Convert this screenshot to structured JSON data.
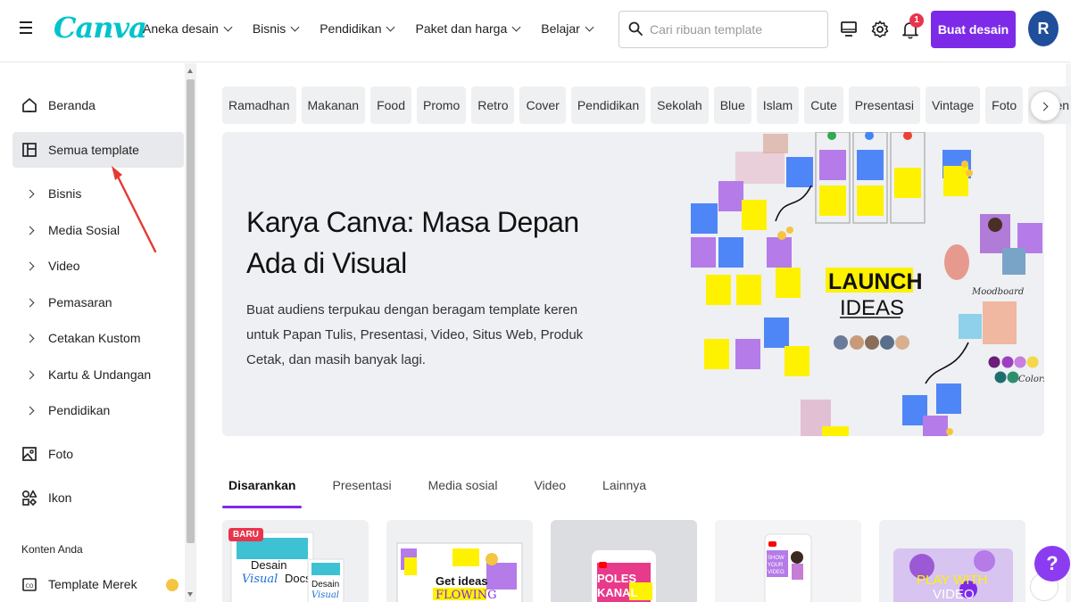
{
  "header": {
    "logo": "Canva",
    "nav": [
      "Aneka desain",
      "Bisnis",
      "Pendidikan",
      "Paket dan harga",
      "Belajar"
    ],
    "search_placeholder": "Cari ribuan template",
    "notification_count": "1",
    "create_label": "Buat desain",
    "avatar_initial": "R"
  },
  "sidebar": {
    "items": [
      {
        "label": "Beranda",
        "icon": "home-icon"
      },
      {
        "label": "Semua template",
        "icon": "template-icon"
      },
      {
        "label": "Bisnis",
        "icon": "chevron-right-icon"
      },
      {
        "label": "Media Sosial",
        "icon": "chevron-right-icon"
      },
      {
        "label": "Video",
        "icon": "chevron-right-icon"
      },
      {
        "label": "Pemasaran",
        "icon": "chevron-right-icon"
      },
      {
        "label": "Cetakan Kustom",
        "icon": "chevron-right-icon"
      },
      {
        "label": "Kartu & Undangan",
        "icon": "chevron-right-icon"
      },
      {
        "label": "Pendidikan",
        "icon": "chevron-right-icon"
      },
      {
        "label": "Foto",
        "icon": "photo-icon"
      },
      {
        "label": "Ikon",
        "icon": "shapes-icon"
      }
    ],
    "section_title": "Konten Anda",
    "brand_item": "Template Merek"
  },
  "chips": [
    "Ramadhan",
    "Makanan",
    "Food",
    "Promo",
    "Retro",
    "Cover",
    "Pendidikan",
    "Sekolah",
    "Blue",
    "Islam",
    "Cute",
    "Presentasi",
    "Vintage",
    "Foto",
    "Green"
  ],
  "hero": {
    "title_line1": "Karya Canva: Masa Depan",
    "title_line2": "Ada di Visual",
    "description": "Buat audiens terpukau dengan beragam template keren untuk Papan Tulis, Presentasi, Video, Situs Web, Produk Cetak, dan masih banyak lagi.",
    "art_launch_line1": "LAUNCH",
    "art_launch_line2": "IDEAS",
    "art_moodboard": "Moodboard",
    "art_colors": "Colors"
  },
  "tabs": [
    "Disarankan",
    "Presentasi",
    "Media sosial",
    "Video",
    "Lainnya"
  ],
  "cards": {
    "new_badge": "BARU",
    "card1_line1": "Desain",
    "card1_line2": "Visual",
    "card1_line3": "Docs",
    "card2_line1": "Get ideas",
    "card2_line2": "FLOWING",
    "card3_line1": "POLES",
    "card3_line2": "KANAL",
    "card4_line1": "SHOW",
    "card4_line2": "YOUR",
    "card4_line3": "VIDEO",
    "card5_line1": "PLAY WITH",
    "card5_line2": "VIDEO"
  },
  "help_label": "?",
  "colors": {
    "brand_teal": "#00c4cc",
    "accent_purple": "#7d2ae8",
    "badge_red": "#e8354b"
  }
}
